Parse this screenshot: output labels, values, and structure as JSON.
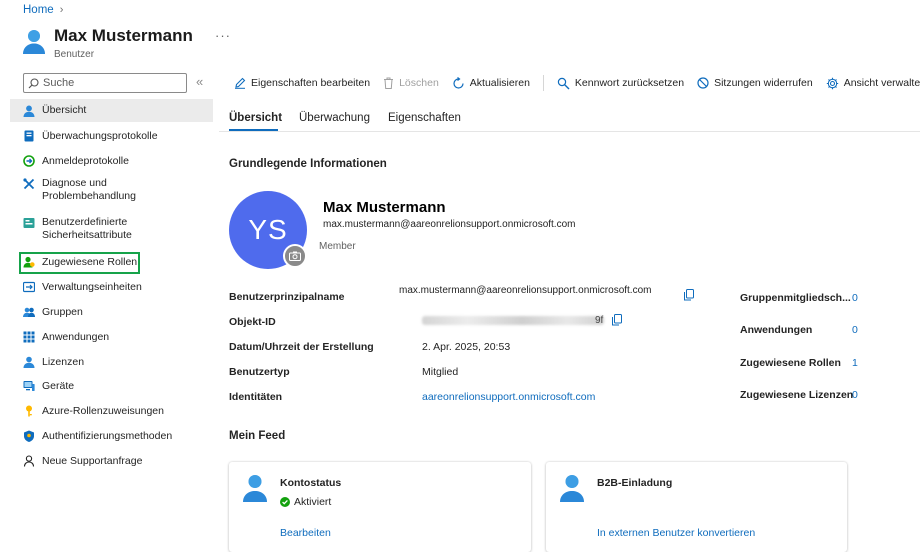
{
  "breadcrumb": {
    "home": "Home"
  },
  "header": {
    "title": "Max Mustermann",
    "subtitle": "Benutzer",
    "more": "···"
  },
  "sidebar": {
    "search_placeholder": "Suche",
    "collapse": "«",
    "items": [
      {
        "label": "Übersicht",
        "icon": "user-icon"
      },
      {
        "label": "Überwachungsprotokolle",
        "icon": "book-icon"
      },
      {
        "label": "Anmeldeprotokolle",
        "icon": "signin-log-icon"
      },
      {
        "label": "Diagnose und Problembehandlung",
        "icon": "wrench-icon"
      },
      {
        "label": "Benutzerdefinierte Sicherheitsattribute",
        "icon": "attribute-icon"
      },
      {
        "label": "Zugewiesene Rollen",
        "icon": "role-icon"
      },
      {
        "label": "Verwaltungseinheiten",
        "icon": "admin-unit-icon"
      },
      {
        "label": "Gruppen",
        "icon": "group-icon"
      },
      {
        "label": "Anwendungen",
        "icon": "apps-grid-icon"
      },
      {
        "label": "Lizenzen",
        "icon": "license-icon"
      },
      {
        "label": "Geräte",
        "icon": "device-icon"
      },
      {
        "label": "Azure-Rollenzuweisungen",
        "icon": "key-icon"
      },
      {
        "label": "Authentifizierungsmethoden",
        "icon": "shield-icon"
      },
      {
        "label": "Neue Supportanfrage",
        "icon": "support-icon"
      }
    ]
  },
  "toolbar": {
    "edit": "Eigenschaften bearbeiten",
    "delete": "Löschen",
    "refresh": "Aktualisieren",
    "reset_password": "Kennwort zurücksetzen",
    "revoke_sessions": "Sitzungen widerrufen",
    "manage_view": "Ansicht verwalten"
  },
  "tabs": [
    "Übersicht",
    "Überwachung",
    "Eigenschaften"
  ],
  "basic_info": {
    "heading": "Grundlegende Informationen",
    "initials": "YS",
    "name": "Max Mustermann",
    "email": "max.mustermann@aareonrelionsupport.onmicrosoft.com",
    "role": "Member"
  },
  "properties": {
    "upn_label": "Benutzerprinzipalname",
    "upn_value": "max.mustermann@aareonrelionsupport.onmicrosoft.com",
    "object_id_label": "Objekt-ID",
    "object_id_suffix": "9f",
    "created_label": "Datum/Uhrzeit der Erstellung",
    "created_value": "2. Apr. 2025, 20:53",
    "type_label": "Benutzertyp",
    "type_value": "Mitglied",
    "identities_label": "Identitäten",
    "identities_value": "aareonrelionsupport.onmicrosoft.com"
  },
  "stats": {
    "groups_label": "Gruppenmitgliedsch...",
    "groups_value": "0",
    "apps_label": "Anwendungen",
    "apps_value": "0",
    "roles_label": "Zugewiesene Rollen",
    "roles_value": "1",
    "licenses_label": "Zugewiesene Lizenzen",
    "licenses_value": "0"
  },
  "feed": {
    "heading": "Mein Feed",
    "account_title": "Kontostatus",
    "account_status": "Aktiviert",
    "account_link": "Bearbeiten",
    "b2b_title": "B2B-Einladung",
    "b2b_link": "In externen Benutzer konvertieren"
  },
  "colors": {
    "accent": "#0f6cbd",
    "avatar": "#4f6bed",
    "highlight": "#16a34a",
    "status_ok": "#13a10e"
  }
}
